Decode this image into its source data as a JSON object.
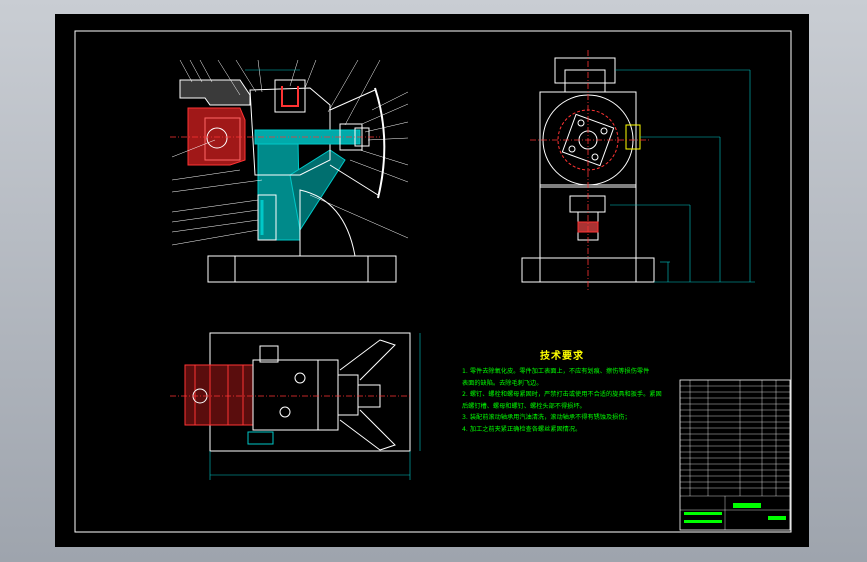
{
  "technical_requirements": {
    "title": "技术要求",
    "notes": [
      "1. 零件去除氧化皮。零件加工表面上，不应有划痕、擦伤等损伤零件",
      "表面的缺陷。去除毛刺飞边。",
      "2. 螺钉、螺栓和螺母紧固时，严禁打击或使用不合适的旋具和扳手。紧固",
      "后螺钉槽、螺母和螺钉、螺栓头部不得损坏。",
      "3. 装配前滚动轴承用汽油清洗，滚动轴承不得有锈蚀及损伤；",
      "4. 加工之前夹紧正确检查各螺丝紧固情况。"
    ]
  },
  "colors": {
    "background": "#000000",
    "outline": "#ffffff",
    "hatch": "#00c8c8",
    "part": "#ff3333",
    "dimension": "#00c8c8",
    "centerline": "#ff3333",
    "leader": "#ffffff",
    "note_title": "#ffff00",
    "note_text": "#00ff00"
  }
}
